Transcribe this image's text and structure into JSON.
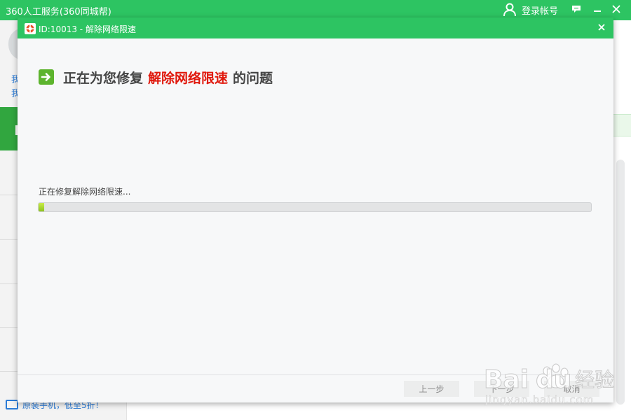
{
  "app": {
    "title": "360人工服务(360同城帮)",
    "login_label": "登录帐号"
  },
  "background": {
    "sidebar_lines": [
      "我",
      "我"
    ],
    "footer_text": "原装手机，低至5折！"
  },
  "dialog": {
    "title": "ID:10013 - 解除网络限速",
    "headline_prefix": "正在为您修复",
    "headline_highlight": "解除网络限速",
    "headline_suffix": "的问题",
    "status_text": "正在修复解除网络限速...",
    "progress": 0.01,
    "buttons": {
      "prev": "上一步",
      "next": "下一步",
      "cancel": "取消"
    }
  },
  "watermark": {
    "brand": "Bai",
    "brand_suffix": "经验",
    "url": "jingyan.baidu.com"
  },
  "colors": {
    "brand_green": "#2dc462",
    "highlight_red": "#e0180c",
    "progress_green": "#8dc21f"
  }
}
